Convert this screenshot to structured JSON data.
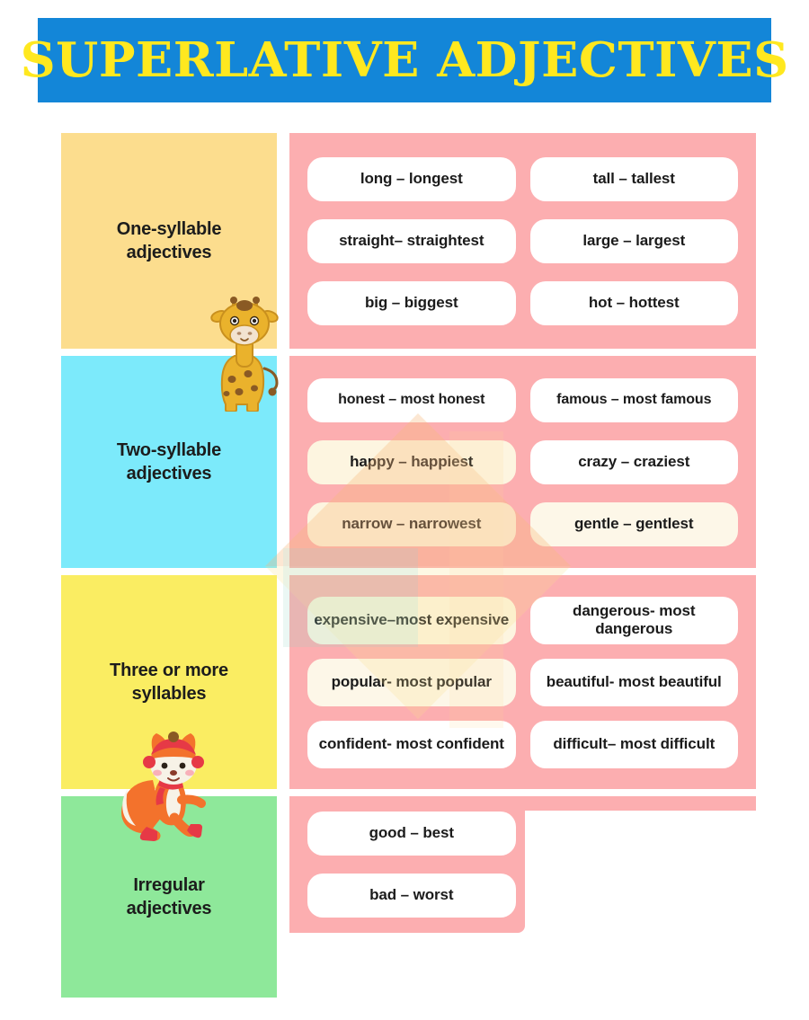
{
  "header": {
    "title": "SUPERLATIVE ADJECTIVES",
    "background_color": "#1386D8",
    "text_color": "#FFE81F"
  },
  "colors": {
    "pink_panel": "#FCAEB0",
    "pill": "#FFFFFF",
    "text": "#1B1B1B"
  },
  "rows": [
    {
      "category": "One-syllable\nadjectives",
      "category_line1": "One-syllable",
      "category_line2": "adjectives",
      "block_color": "#FCDD8E",
      "pairs": [
        {
          "text": "long – longest"
        },
        {
          "text": "tall – tallest"
        },
        {
          "text": "straight– straightest"
        },
        {
          "text": "large – largest"
        },
        {
          "text": "big – biggest"
        },
        {
          "text": "hot – hottest"
        }
      ]
    },
    {
      "category": "Two-syllable\nadjectives",
      "category_line1": "Two-syllable",
      "category_line2": "adjectives",
      "block_color": "#7CEAFB",
      "pairs": [
        {
          "text": "honest – most honest"
        },
        {
          "text": "famous – most famous"
        },
        {
          "text": "happy – happiest"
        },
        {
          "text": "crazy – craziest"
        },
        {
          "text": "narrow – narrowest"
        },
        {
          "text": "gentle – gentlest"
        }
      ]
    },
    {
      "category": "Three or more\nsyllables",
      "category_line1": "Three or more",
      "category_line2": "syllables",
      "block_color": "#FAED62",
      "pairs": [
        {
          "text": "expensive–most expensive"
        },
        {
          "text": "dangerous- most dangerous"
        },
        {
          "text": "popular- most popular"
        },
        {
          "text": "beautiful- most beautiful"
        },
        {
          "text": "confident- most confident"
        },
        {
          "text": "difficult– most difficult"
        }
      ]
    },
    {
      "category": "Irregular\nadjectives",
      "category_line1": "Irregular",
      "category_line2": "adjectives",
      "block_color": "#8EE89A",
      "pairs": [
        {
          "text": "good – best"
        },
        {
          "text": "bad – worst"
        }
      ]
    }
  ],
  "mascots": [
    {
      "name": "giraffe",
      "colors": [
        "#EDB229",
        "#7A4A1E"
      ]
    },
    {
      "name": "fox",
      "colors": [
        "#F3722C",
        "#E63946"
      ]
    }
  ]
}
